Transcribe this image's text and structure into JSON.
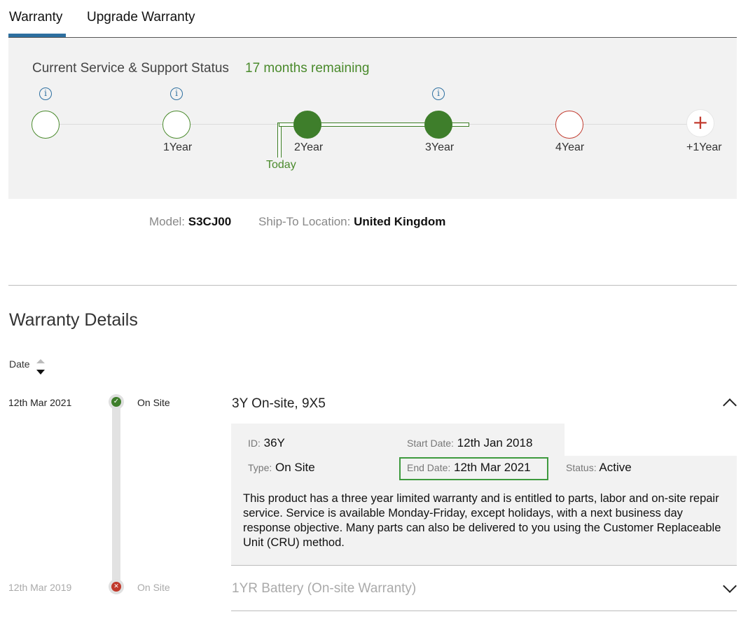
{
  "tabs": {
    "warranty": "Warranty",
    "upgrade": "Upgrade Warranty"
  },
  "status": {
    "heading": "Current Service & Support Status",
    "remaining": "17 months remaining",
    "today": "Today",
    "nodes": [
      "",
      "1Year",
      "2Year",
      "3Year",
      "4Year",
      "+1Year"
    ],
    "plus_symbol": "+",
    "info_symbol": "i"
  },
  "model": {
    "model_label": "Model:",
    "model_value": "S3CJ00",
    "ship_label": "Ship-To Location:",
    "ship_value": "United Kingdom"
  },
  "details": {
    "title": "Warranty Details",
    "sort_label": "Date",
    "rows": [
      {
        "date": "12th Mar 2021",
        "type": "On Site",
        "title": "3Y On-site, 9X5",
        "id_label": "ID:",
        "id_value": "36Y",
        "start_label": "Start Date:",
        "start_value": "12th Jan 2018",
        "type_label": "Type:",
        "type_value": "On Site",
        "end_label": "End Date:",
        "end_value": "12th Mar 2021",
        "status_label": "Status:",
        "status_value": "Active",
        "description": "This product has a three year limited warranty and is entitled to parts, labor and on-site repair service. Service is available Monday-Friday, except holidays, with a next business day response objective. Many parts can also be delivered to you using the Customer Replaceable Unit (CRU) method."
      },
      {
        "date": "12th Mar 2019",
        "type": "On Site",
        "title": "1YR Battery (On-site Warranty)"
      }
    ]
  },
  "colors": {
    "accent_green": "#3e7e2b",
    "accent_blue": "#2d6fa0",
    "alert_red": "#c23b2f"
  }
}
